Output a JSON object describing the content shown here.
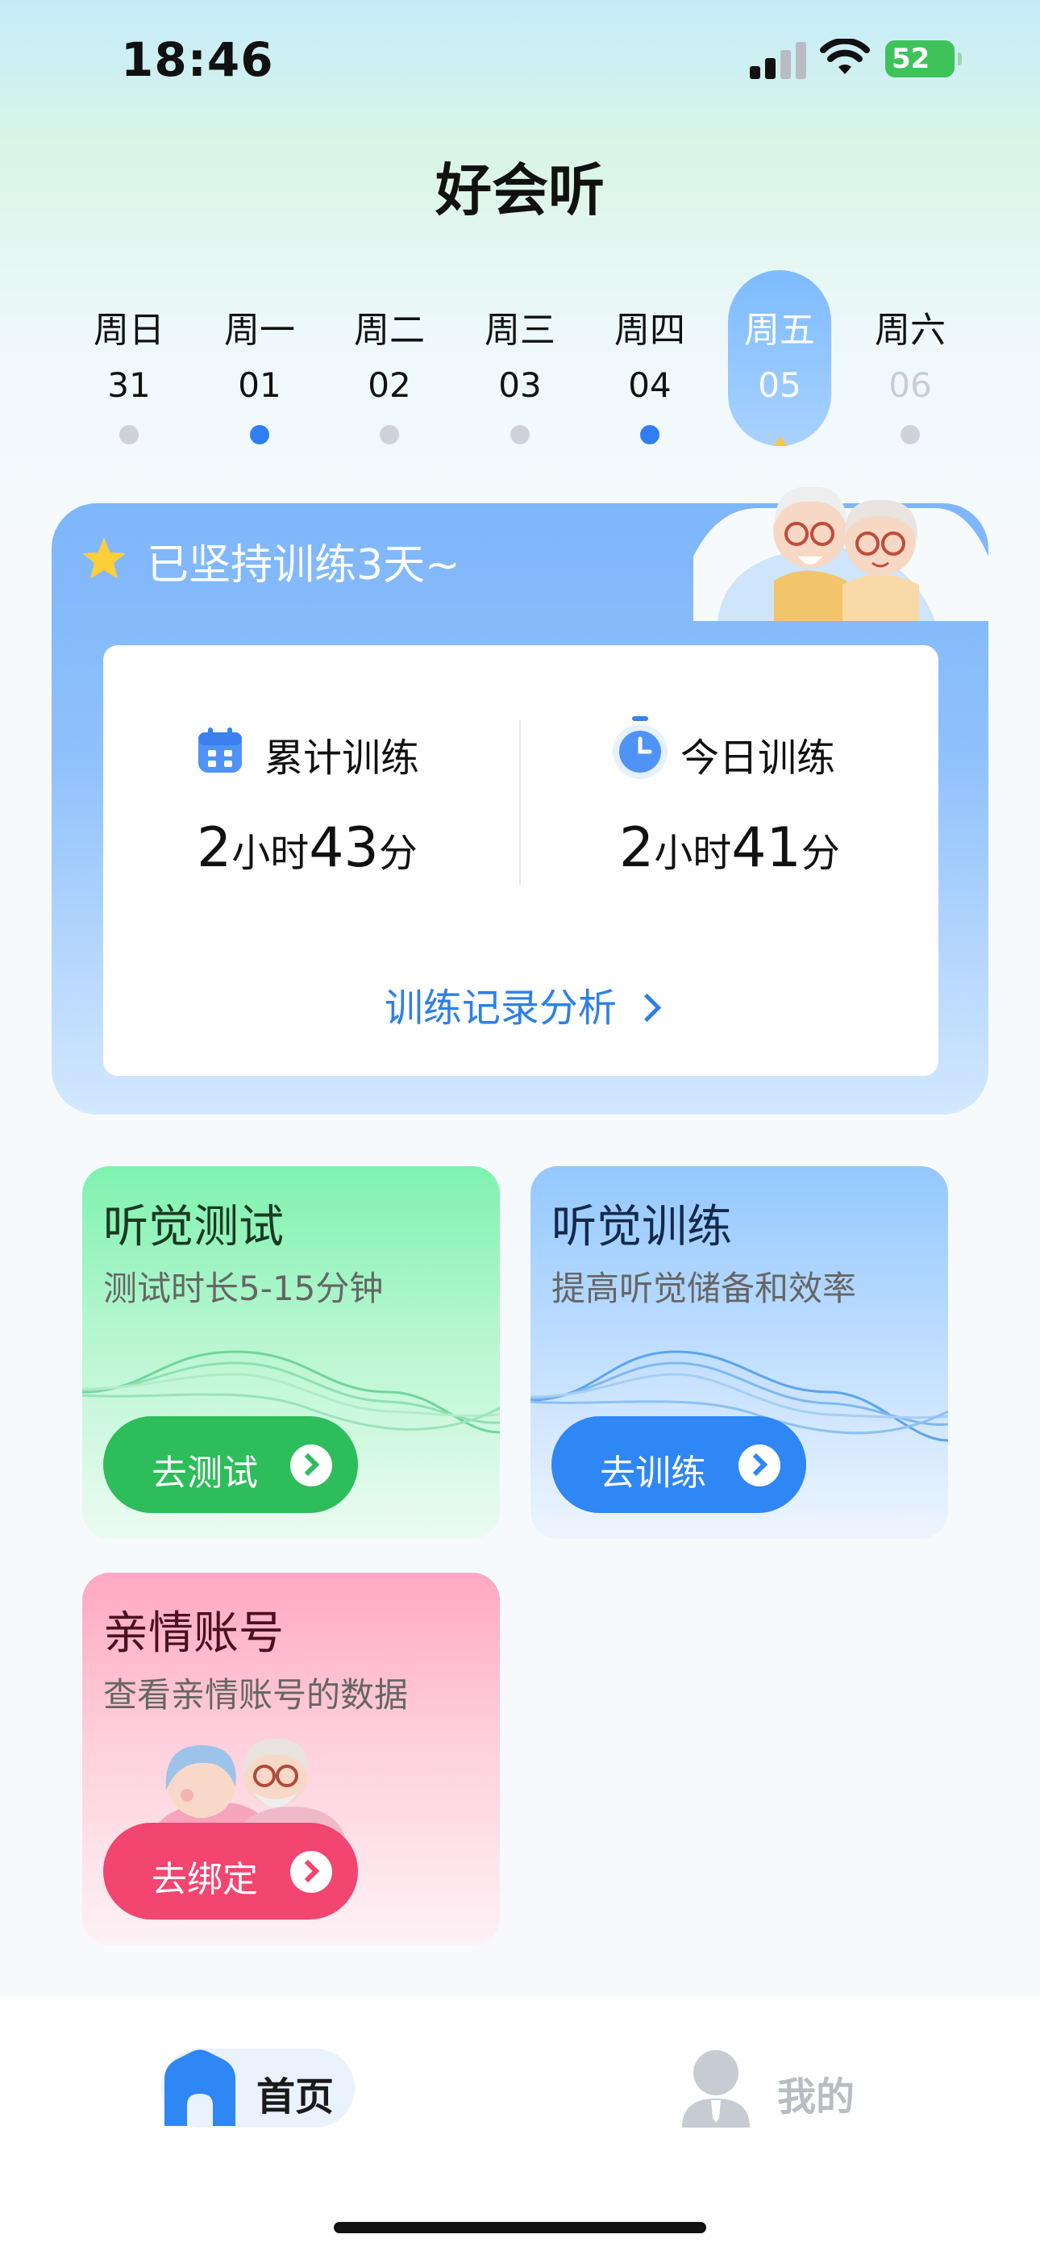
{
  "status_bar": {
    "time": "18:46",
    "battery": "52"
  },
  "header": {
    "title": "好会听"
  },
  "week": [
    {
      "weekday": "周日",
      "date": "31",
      "has_record": false,
      "state": "past"
    },
    {
      "weekday": "周一",
      "date": "01",
      "has_record": true,
      "state": "past"
    },
    {
      "weekday": "周二",
      "date": "02",
      "has_record": false,
      "state": "past"
    },
    {
      "weekday": "周三",
      "date": "03",
      "has_record": false,
      "state": "past"
    },
    {
      "weekday": "周四",
      "date": "04",
      "has_record": true,
      "state": "past"
    },
    {
      "weekday": "周五",
      "date": "05",
      "has_record": false,
      "state": "selected"
    },
    {
      "weekday": "周六",
      "date": "06",
      "has_record": false,
      "state": "future"
    }
  ],
  "training": {
    "streak_text": "已坚持训练3天~",
    "total_label": "累计训练",
    "total_hours": "2",
    "total_hours_unit": "小时",
    "total_minutes": "43",
    "total_minutes_unit": "分",
    "today_label": "今日训练",
    "today_hours": "2",
    "today_hours_unit": "小时",
    "today_minutes": "41",
    "today_minutes_unit": "分",
    "analysis_link": "训练记录分析"
  },
  "tiles": {
    "hearing_test": {
      "title": "听觉测试",
      "subtitle": "测试时长5-15分钟",
      "button": "去测试"
    },
    "hearing_training": {
      "title": "听觉训练",
      "subtitle": "提高听觉储备和效率",
      "button": "去训练"
    },
    "family_account": {
      "title": "亲情账号",
      "subtitle": "查看亲情账号的数据",
      "button": "去绑定"
    }
  },
  "tab_bar": {
    "home": "首页",
    "mine": "我的"
  },
  "colors": {
    "accent_blue": "#2f7ff3",
    "green": "#2dbd5a",
    "pink": "#f2456f"
  }
}
